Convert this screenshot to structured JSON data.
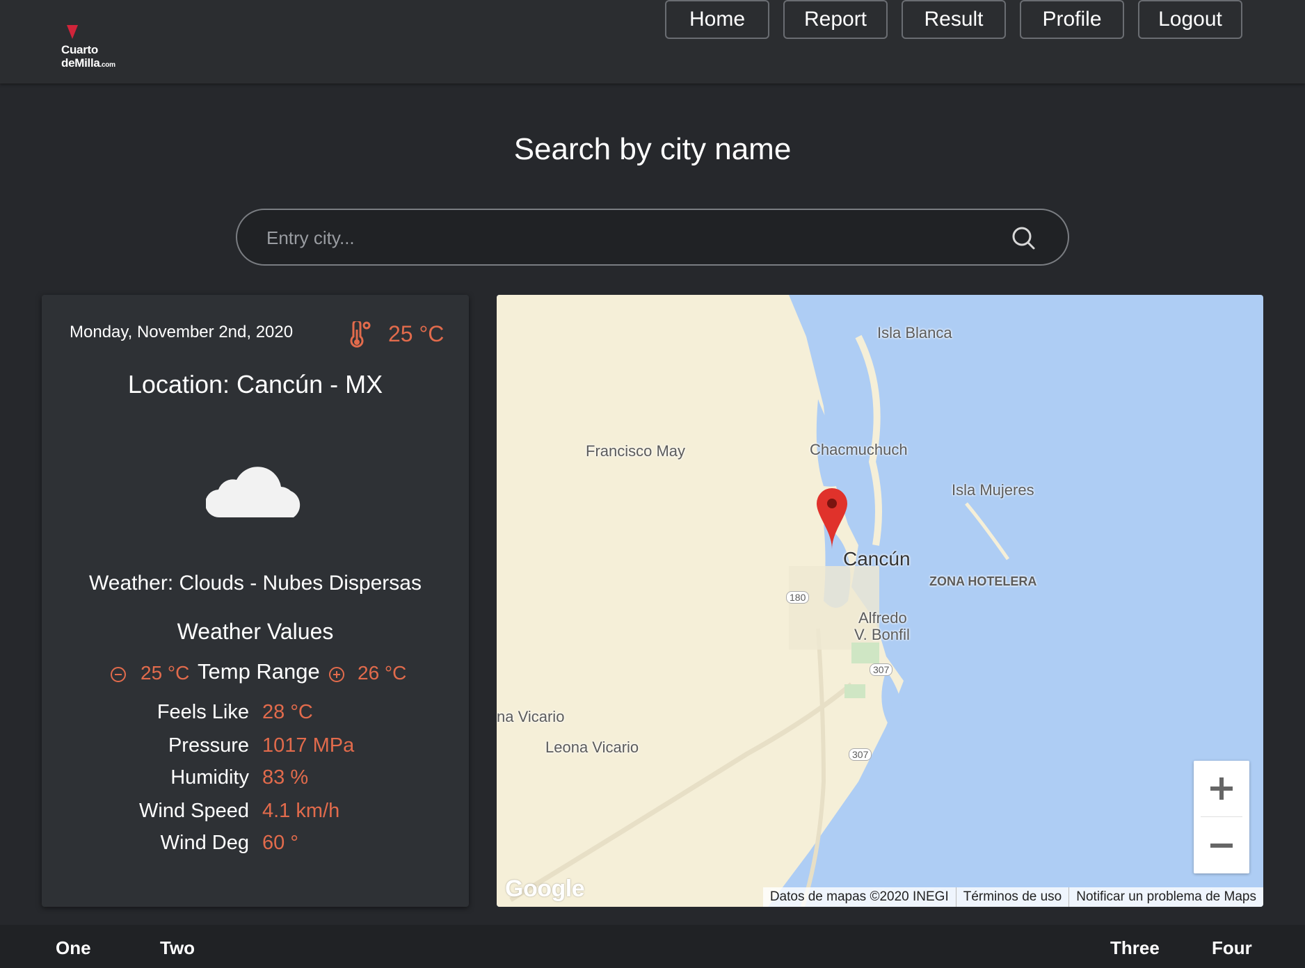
{
  "brand": {
    "line1": "Cuarto",
    "line2": "deMilla",
    "suffix": ".com",
    "accent": "#d0243a"
  },
  "nav": [
    "Home",
    "Report",
    "Result",
    "Profile",
    "Logout"
  ],
  "search": {
    "title": "Search by city name",
    "placeholder": "Entry city...",
    "value": "",
    "icon": "search-icon"
  },
  "weather_card": {
    "date": "Monday, November 2nd, 2020",
    "temp": "25 °C",
    "location": "Location: Cancún - MX",
    "icon": "cloud-icon",
    "weather": "Weather: Clouds - Nubes Dispersas",
    "values_title": "Weather Values",
    "temp_range": {
      "min": "25 °C",
      "label": "Temp Range",
      "max": "26 °C"
    },
    "values": [
      {
        "label": "Feels Like",
        "value": "28 °C"
      },
      {
        "label": "Pressure",
        "value": "1017 MPa"
      },
      {
        "label": "Humidity",
        "value": "83 %"
      },
      {
        "label": "Wind Speed",
        "value": "4.1 km/h"
      },
      {
        "label": "Wind Deg",
        "value": "60 °"
      }
    ],
    "accent": "#e26b4c"
  },
  "map": {
    "labels": {
      "isla_blanca": "Isla Blanca",
      "francisco_may": "Francisco May",
      "chacmuchuch": "Chacmuchuch",
      "isla_mujeres": "Isla Mujeres",
      "cancun": "Cancún",
      "zona_hotelera": "ZONA HOTELERA",
      "alfredo": "Alfredo",
      "bonfil": "V. Bonfil",
      "na_vicario": "na Vicario",
      "leona_vicario": "Leona Vicario"
    },
    "shields": [
      "180",
      "307",
      "307"
    ],
    "google": "Google",
    "attribution": [
      "Datos de mapas ©2020 INEGI",
      "Términos de uso",
      "Notificar un problema de Maps"
    ],
    "zoom_in": "+",
    "zoom_out": "−",
    "land_color": "#f5efd8",
    "water_color": "#aecdf4"
  },
  "footer": [
    "One",
    "Two",
    "Three",
    "Four"
  ]
}
